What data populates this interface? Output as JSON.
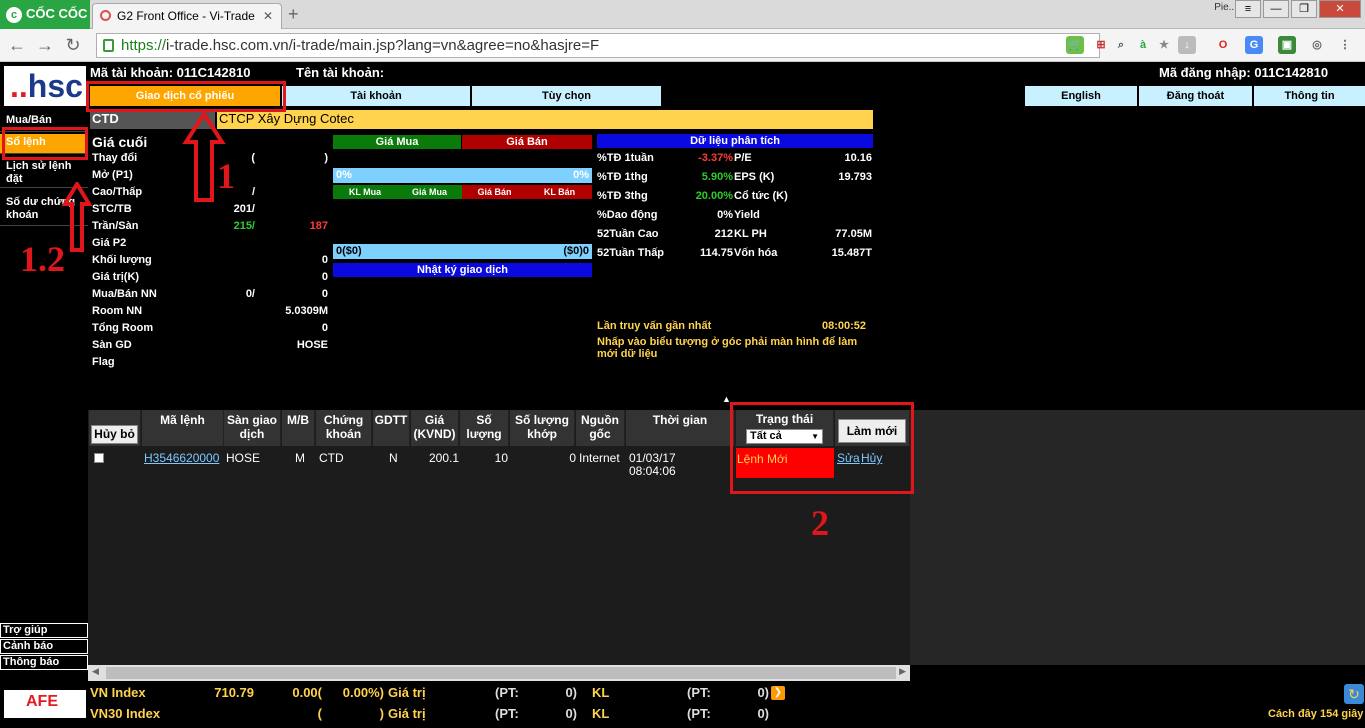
{
  "browser": {
    "brand": "CỐC CỐC",
    "tab_title": "G2 Front Office - Vi-Trade",
    "profile": "Pie...",
    "url_secure": "https://",
    "url_rest": "i-trade.hsc.com.vn/i-trade/main.jsp?lang=vn&agree=no&hasjre=F"
  },
  "header": {
    "account_no": "Mã tài khoản: 011C142810",
    "account_name": "Tên tài khoản:",
    "login_id": "Mã đăng nhập: 011C142810"
  },
  "menu": {
    "stock_trading": "Giao dịch cổ phiếu",
    "account": "Tài khoản",
    "options": "Tùy chọn",
    "english": "English",
    "logout": "Đăng thoát",
    "info": "Thông tin"
  },
  "sidebar": {
    "logo": "hsc",
    "items": [
      "Mua/Bán",
      "Sổ lệnh",
      "Lịch sử lệnh đặt",
      "Số dư chứng khoán"
    ],
    "bottom": [
      "Trợ giúp",
      "Cảnh báo",
      "Thông báo"
    ]
  },
  "quote": {
    "symbol": "CTD",
    "company": "CTCP Xây Dựng Cotec",
    "last_label": "Giá cuối",
    "rows": [
      {
        "label": "Thay đổi",
        "v1": "(",
        "v2": ")"
      },
      {
        "label": "Mở (P1)",
        "v1": "",
        "v2": ""
      },
      {
        "label": "Cao/Thấp",
        "v1": "/",
        "v2": ""
      },
      {
        "label": "STC/TB",
        "v1": "201/",
        "v2": ""
      },
      {
        "label": "Trần/Sàn",
        "v1": "215/",
        "v2": "187"
      },
      {
        "label": "Giá P2",
        "v1": "",
        "v2": ""
      },
      {
        "label": "Khối lượng",
        "v1": "",
        "v2": "0"
      },
      {
        "label": "Giá trị(K)",
        "v1": "",
        "v2": "0"
      },
      {
        "label": "Mua/Bán NN",
        "v1": "0/",
        "v2": "0"
      },
      {
        "label": "Room NN",
        "v1": "",
        "v2": "5.0309M"
      },
      {
        "label": "Tổng Room",
        "v1": "",
        "v2": "0"
      },
      {
        "label": "Sàn GD",
        "v1": "",
        "v2": "HOSE"
      },
      {
        "label": "Flag",
        "v1": "",
        "v2": ""
      }
    ]
  },
  "depth": {
    "buy": "Giá Mua",
    "sell": "Giá Bán",
    "buy_pct": "0%",
    "sell_pct": "0%",
    "kl_mua": "KL Mua",
    "gia_mua": "Giá Mua",
    "gia_ban": "Giá Bán",
    "kl_ban": "KL Bán",
    "total_left": "0($0)",
    "total_right": "($0)0",
    "journal": "Nhật ký giao dịch"
  },
  "analysis": {
    "title": "Dữ liệu phân tích",
    "rows": [
      {
        "l1": "%TĐ 1tuần",
        "v1": "-3.37%",
        "l2": "P/E",
        "v2": "10.16",
        "c": "red"
      },
      {
        "l1": "%TĐ 1thg",
        "v1": "5.90%",
        "l2": "EPS (K)",
        "v2": "19.793",
        "c": "green"
      },
      {
        "l1": "%TĐ 3thg",
        "v1": "20.00%",
        "l2": "Cổ tức (K)",
        "v2": "",
        "c": "green"
      },
      {
        "l1": "%Dao động",
        "v1": "0%",
        "l2": "Yield",
        "v2": "",
        "c": "white"
      },
      {
        "l1": "52Tuần Cao",
        "v1": "212",
        "l2": "KL PH",
        "v2": "77.05M",
        "c": "white"
      },
      {
        "l1": "52Tuần Thấp",
        "v1": "114.75",
        "l2": "Vốn hóa",
        "v2": "15.487T",
        "c": "white"
      }
    ],
    "last_query": "Lần truy vấn gần nhất",
    "last_time": "08:00:52",
    "hint": "Nhấp vào biểu tượng ở góc phải màn hình để làm mới dữ liệu"
  },
  "orders": {
    "cancel_btn": "Hủy bỏ",
    "headers": [
      "Mã lệnh",
      "Sàn giao dịch",
      "M/B",
      "Chứng khoán",
      "GDTT",
      "Giá (KVND)",
      "Số lượng",
      "Số lượng khớp",
      "Nguồn gốc",
      "Thời gian",
      "Trạng thái"
    ],
    "status_filter": "Tất cả",
    "refresh_btn": "Làm mới",
    "row": {
      "order_id": "H3546620000",
      "exchange": "HOSE",
      "side": "M",
      "symbol": "CTD",
      "gdtt": "N",
      "price": "200.1",
      "qty": "10",
      "matched": "0",
      "source": "Internet",
      "time": "01/03/17 08:04:06",
      "status": "Lệnh Mới",
      "edit": "Sửa",
      "cancel": "Hủy"
    }
  },
  "footer": {
    "vn": {
      "name": "VN Index",
      "value": "710.79",
      "chg": "0.00(",
      "pct": "0.00%)",
      "gt": "Giá trị",
      "pt": "(PT:",
      "pt_v": "0)",
      "kl": "KL",
      "pt2": "(PT:",
      "pt2_v": "0)"
    },
    "vn30": {
      "name": "VN30 Index",
      "value": "",
      "chg": "(",
      "pct": ")",
      "gt": "Giá trị",
      "pt": "(PT:",
      "pt_v": "0)",
      "kl": "KL",
      "pt2": "(PT:",
      "pt2_v": "0)"
    },
    "ago": "Cách đây 154 giây",
    "afe": "AFE"
  },
  "annotations": {
    "a1": "1",
    "a12": "1.2",
    "a2": "2"
  }
}
